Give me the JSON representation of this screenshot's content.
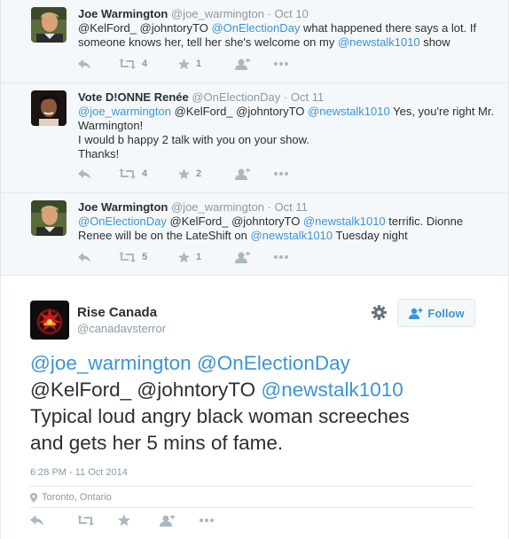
{
  "replies": [
    {
      "name": "Joe Warmington",
      "handle": "@joe_warmington",
      "dot": "·",
      "time": "Oct 10",
      "segments": [
        {
          "t": "@KelFord_ @johntoryTO ",
          "m": false
        },
        {
          "t": "@OnElectionDay",
          "m": true
        },
        {
          "t": " what happened there says a lot. If someone knows her, tell her she's welcome on my ",
          "m": false
        },
        {
          "t": "@newstalk1010",
          "m": true
        },
        {
          "t": " show",
          "m": false
        }
      ],
      "retweets": "4",
      "favorites": "1"
    },
    {
      "name": "Vote D!ONNE Renée",
      "handle": "@OnElectionDay",
      "dot": "·",
      "time": "Oct 11",
      "segments": [
        {
          "t": "@joe_warmington",
          "m": true
        },
        {
          "t": " @KelFord_ @johntoryTO ",
          "m": false
        },
        {
          "t": "@newstalk1010",
          "m": true
        },
        {
          "t": "  Yes, you're right Mr. Warmington!\nI would b happy 2 talk with you on your show.\nThanks!",
          "m": false
        }
      ],
      "retweets": "4",
      "favorites": "2"
    },
    {
      "name": "Joe Warmington",
      "handle": "@joe_warmington",
      "dot": "·",
      "time": "Oct 11",
      "segments": [
        {
          "t": "@OnElectionDay",
          "m": true
        },
        {
          "t": " @KelFord_ @johntoryTO ",
          "m": false
        },
        {
          "t": "@newstalk1010",
          "m": true
        },
        {
          "t": " terrific. Dionne Renee will be on the LateShift on ",
          "m": false
        },
        {
          "t": "@newstalk1010",
          "m": true
        },
        {
          "t": " Tuesday night",
          "m": false
        }
      ],
      "retweets": "5",
      "favorites": "1"
    }
  ],
  "main_tweet": {
    "name": "Rise Canada",
    "handle": "@canadavsterror",
    "follow_label": "Follow",
    "segments": [
      {
        "t": "@joe_warmington",
        "m": true
      },
      {
        "t": " ",
        "m": false
      },
      {
        "t": "@OnElectionDay",
        "m": true
      },
      {
        "t": "\n@KelFord_ @johntoryTO ",
        "m": false
      },
      {
        "t": "@newstalk1010",
        "m": true
      },
      {
        "t": "\nTypical loud angry black woman screeches\nand gets her 5 mins of fame.",
        "m": false
      }
    ],
    "timestamp": "6:28 PM - 11 Oct 2014",
    "location": "Toronto, Ontario"
  },
  "colors": {
    "link": "#3b94d9",
    "muted": "#8899a6",
    "text": "#292f33",
    "convo_bg": "#f5f8fa",
    "border": "#e1e8ed"
  },
  "icons": [
    "reply-icon",
    "retweet-icon",
    "favorite-icon",
    "follow-plus-icon",
    "more-icon",
    "gear-icon",
    "location-pin-icon"
  ]
}
